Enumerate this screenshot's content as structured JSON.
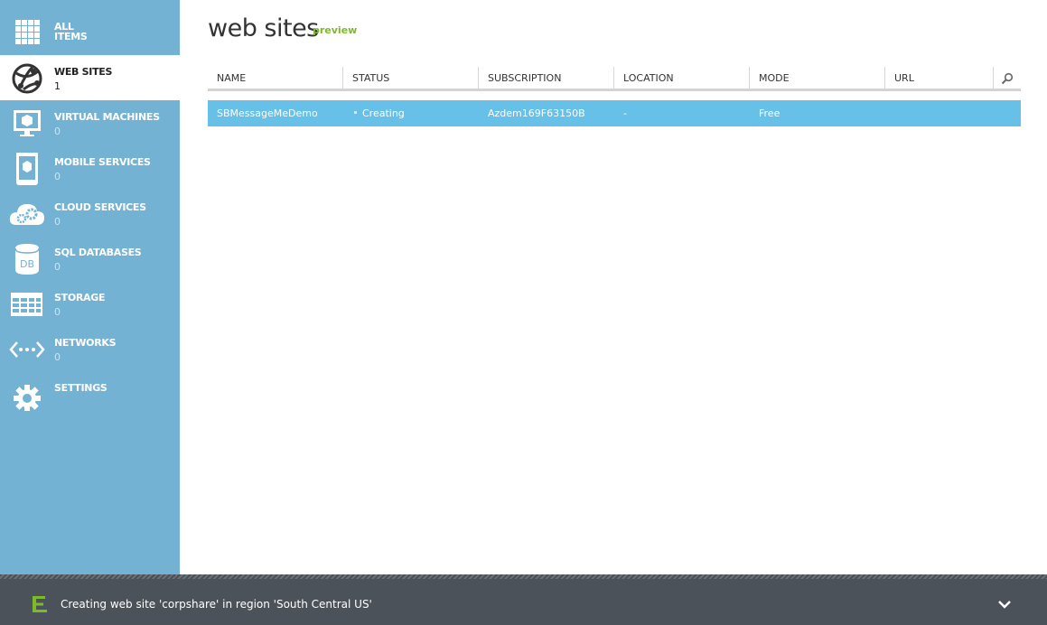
{
  "sidebar": {
    "all_items": {
      "line1": "ALL",
      "line2": "ITEMS"
    },
    "items": [
      {
        "label": "WEB SITES",
        "count": "1",
        "icon": "globe-icon"
      },
      {
        "label": "VIRTUAL MACHINES",
        "count": "0",
        "icon": "monitor-icon"
      },
      {
        "label": "MOBILE SERVICES",
        "count": "0",
        "icon": "mobile-phone-icon"
      },
      {
        "label": "CLOUD SERVICES",
        "count": "0",
        "icon": "cloud-gears-icon"
      },
      {
        "label": "SQL DATABASES",
        "count": "0",
        "icon": "database-icon"
      },
      {
        "label": "STORAGE",
        "count": "0",
        "icon": "storage-table-icon"
      },
      {
        "label": "NETWORKS",
        "count": "0",
        "icon": "network-icon"
      },
      {
        "label": "SETTINGS",
        "icon": "gear-icon"
      }
    ]
  },
  "main": {
    "title": "web sites",
    "preview_label": "preview",
    "columns": [
      "NAME",
      "STATUS",
      "SUBSCRIPTION",
      "LOCATION",
      "MODE",
      "URL"
    ],
    "rows": [
      {
        "name": "SBMessageMeDemo",
        "status": "Creating",
        "subscription": "Azdem169F63150B",
        "location": "-",
        "mode": "Free",
        "url": ""
      }
    ]
  },
  "notification": {
    "text": "Creating web site 'corpshare' in region 'South Central US'"
  },
  "colors": {
    "sidebar": "#74b2d3",
    "selected_row": "#66c0e8",
    "preview": "#7cbb27",
    "bottom_bar": "#4b5259"
  }
}
